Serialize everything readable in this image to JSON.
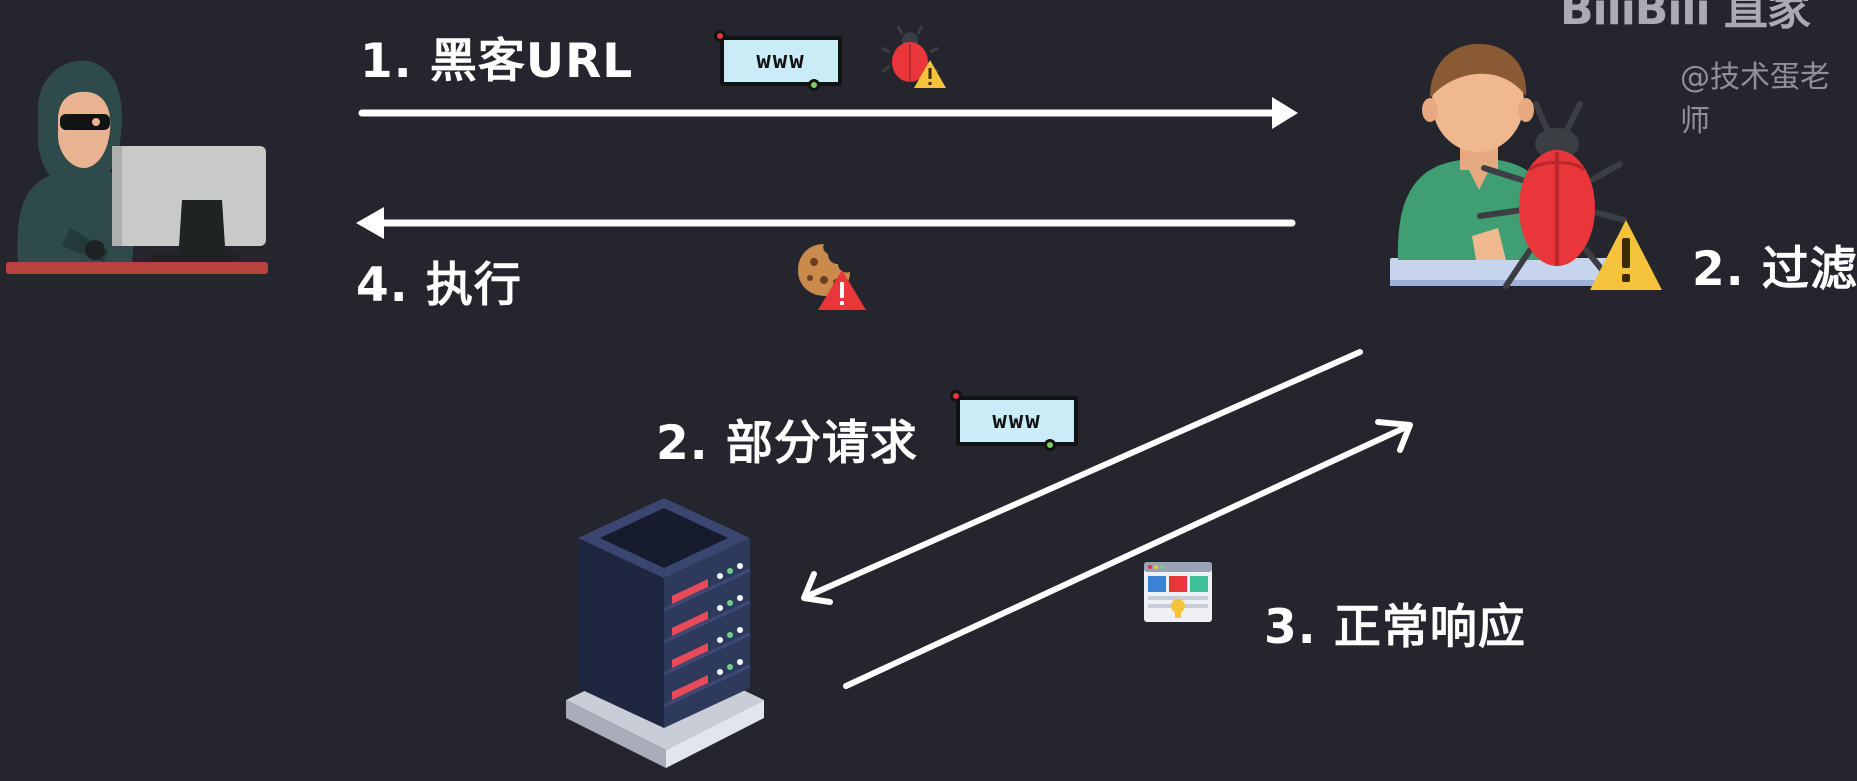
{
  "steps": {
    "step1": "1. 黑客URL",
    "step2_filter": "2. 过滤",
    "step2_partial": "2. 部分请求",
    "step3": "3. 正常响应",
    "step4": "4. 执行"
  },
  "icons": {
    "www_label": "www",
    "hacker": "hacker-at-computer-icon",
    "user": "victim-user-icon",
    "server": "server-rack-icon",
    "bug": "bug-icon",
    "warning": "warning-icon",
    "cookie": "cookie-icon",
    "webpage": "webpage-icon"
  },
  "watermark": {
    "logo": "BiliBili 直家",
    "handle": "@技术蛋老师"
  },
  "colors": {
    "background": "#25252d",
    "text": "#ffffff",
    "arrow": "#ffffff",
    "bug_red": "#e8363b",
    "warning_yellow": "#f5c33b",
    "www_fill": "#c9ecf7"
  }
}
